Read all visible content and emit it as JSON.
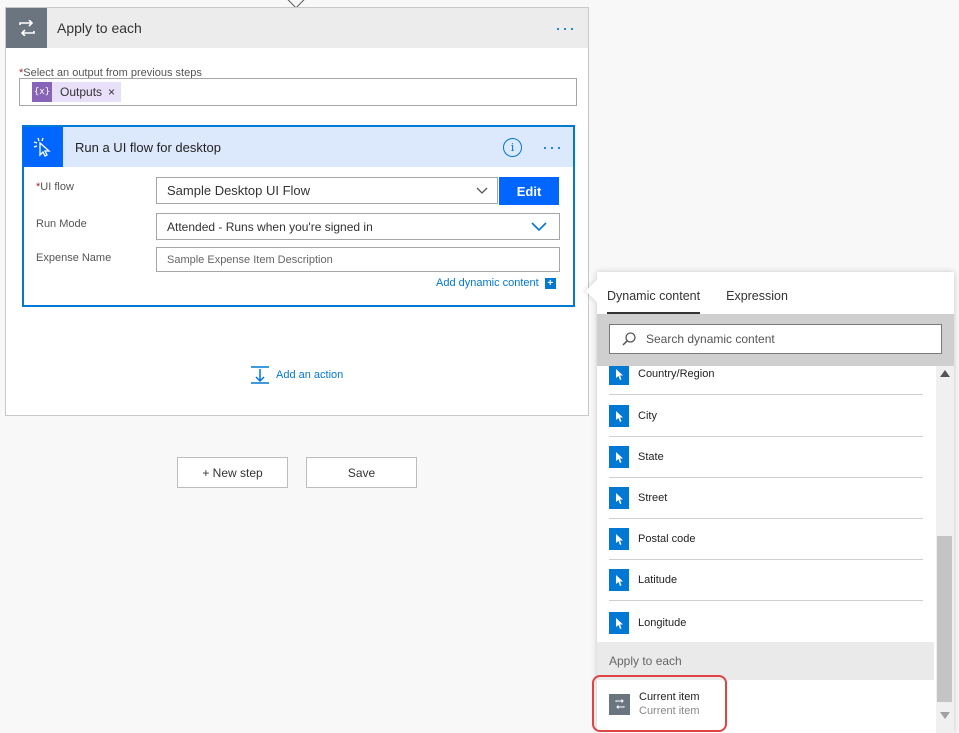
{
  "apply_to_each": {
    "title": "Apply to each",
    "menu": "···",
    "output_label_required": "*",
    "output_label": "Select an output from previous steps",
    "token_icon": "{x}",
    "token_label": "Outputs",
    "token_remove": "×"
  },
  "ui_flow_card": {
    "title": "Run a UI flow for desktop",
    "info": "i",
    "menu": "···",
    "ui_flow_label_required": "*",
    "ui_flow_label": "UI flow",
    "ui_flow_value": "Sample Desktop UI Flow",
    "edit_label": "Edit",
    "run_mode_label": "Run Mode",
    "run_mode_value": "Attended - Runs when you're signed in",
    "expense_label": "Expense Name",
    "expense_placeholder": "Sample Expense Item Description",
    "add_dynamic_label": "Add dynamic content",
    "add_dynamic_plus": "+"
  },
  "add_action_label": "Add an action",
  "footer": {
    "new_step_label": "+ New step",
    "save_label": "Save"
  },
  "flyout": {
    "tabs": [
      "Dynamic content",
      "Expression"
    ],
    "active_tab": "Dynamic content",
    "search_placeholder": "Search dynamic content",
    "items": [
      "Country/Region",
      "City",
      "State",
      "Street",
      "Postal code",
      "Latitude",
      "Longitude"
    ],
    "section_title": "Apply to each",
    "current_item_title": "Current item",
    "current_item_subtitle": "Current item"
  },
  "colors": {
    "accent": "#0078d4",
    "flow_blue": "#0066ff",
    "token_purple": "#8764b8",
    "highlight_red": "#e04343"
  }
}
